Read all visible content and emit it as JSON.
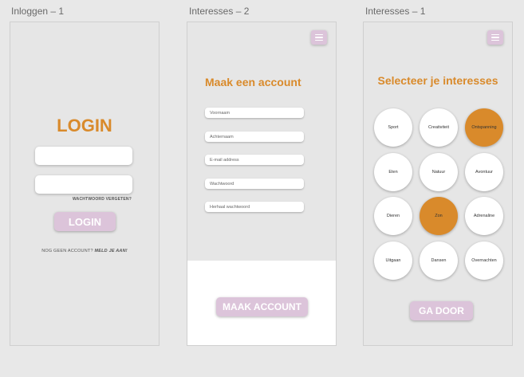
{
  "colors": {
    "accent": "#d98a2b",
    "button": "#dcc4da",
    "canvas": "#e8e8e8",
    "artboard": "#e6e6e6",
    "selected_bubble": "#d98a2b"
  },
  "artboards": {
    "login": {
      "label": "Inloggen – 1",
      "title": "LOGIN",
      "forgot_password": "WACHTWOORD VERGETEN?",
      "login_button": "LOGIN",
      "no_account_text": "NOG GEEN ACCOUNT?",
      "signup_link": "MELD JE AAN!"
    },
    "register": {
      "label": "Interesses – 2",
      "title": "Maak een account",
      "menu_icon": "hamburger-menu-icon",
      "fields": [
        {
          "placeholder": "Voornaam"
        },
        {
          "placeholder": "Achternaam"
        },
        {
          "placeholder": "E-mail address"
        },
        {
          "placeholder": "Wachtwoord"
        },
        {
          "placeholder": "Herhaal wachtwoord"
        }
      ],
      "submit_button": "MAAK ACCOUNT"
    },
    "interests": {
      "label": "Interesses – 1",
      "title": "Selecteer je interesses",
      "menu_icon": "hamburger-menu-icon",
      "options": [
        {
          "label": "Sport",
          "selected": false
        },
        {
          "label": "Creativiteit",
          "selected": false
        },
        {
          "label": "Ontspanning",
          "selected": true
        },
        {
          "label": "Eten",
          "selected": false
        },
        {
          "label": "Natuur",
          "selected": false
        },
        {
          "label": "Avontuur",
          "selected": false
        },
        {
          "label": "Dieren",
          "selected": false
        },
        {
          "label": "Zon",
          "selected": true
        },
        {
          "label": "Adrenaline",
          "selected": false
        },
        {
          "label": "Uitgaan",
          "selected": false
        },
        {
          "label": "Dansen",
          "selected": false
        },
        {
          "label": "Overnachten",
          "selected": false
        }
      ],
      "continue_button": "GA DOOR"
    }
  }
}
